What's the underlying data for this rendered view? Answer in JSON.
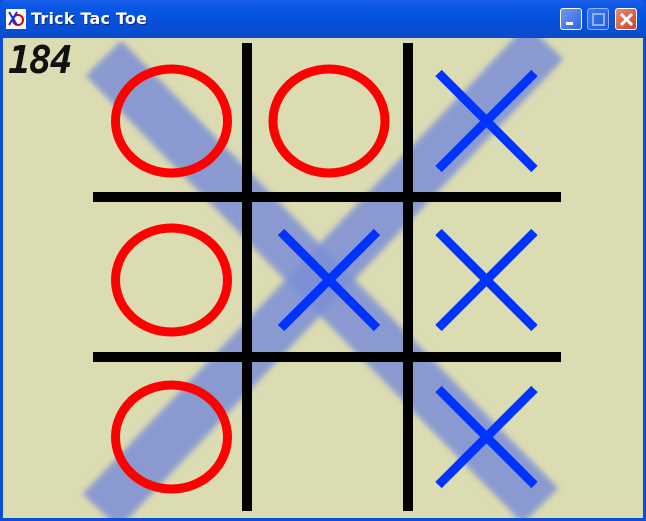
{
  "window": {
    "title": "Trick Tac Toe",
    "buttons": [
      "minimize",
      "maximize",
      "close"
    ],
    "colors": {
      "titlebar": "#0a56e6",
      "client_bg": "#dcdcb2"
    }
  },
  "game": {
    "counter": "184",
    "board": [
      [
        "O",
        "O",
        "X"
      ],
      [
        "O",
        "X",
        "X"
      ],
      [
        "O",
        "",
        "X"
      ]
    ],
    "win_line": "diagonal top-right to bottom-left",
    "colors": {
      "o_mark": "#ff0000",
      "x_mark": "#0033ff",
      "grid": "#000000",
      "win_highlight": "#7b8fd6"
    },
    "icons": {
      "app": "tic-tac-toe-icon",
      "minimize": "minimize-icon",
      "maximize": "maximize-icon",
      "close": "close-icon"
    }
  }
}
